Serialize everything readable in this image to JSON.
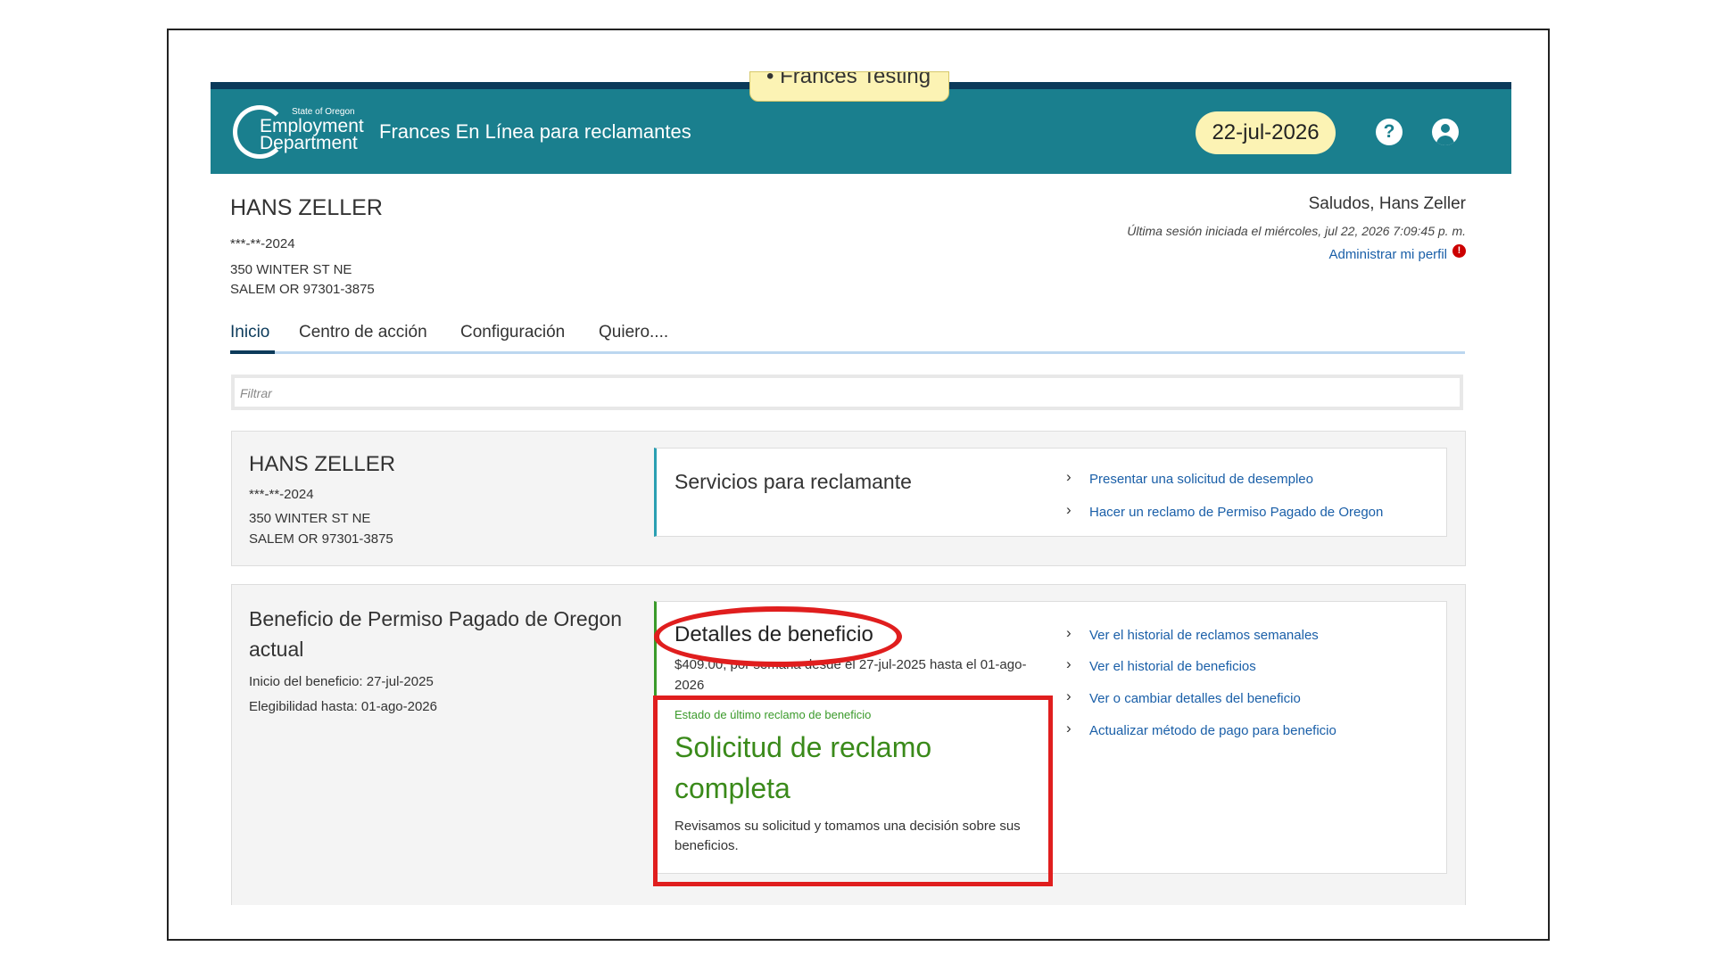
{
  "header": {
    "testing_tab": "• Frances Testing",
    "logo": {
      "small": "State of Oregon",
      "line1": "Employment",
      "line2": "Department"
    },
    "app_title": "Frances En Línea para reclamantes",
    "date": "22-jul-2026"
  },
  "profile": {
    "name": "HANS ZELLER",
    "ssn": "***-**-2024",
    "address1": "350 WINTER ST NE",
    "address2": "SALEM OR 97301-3875",
    "greeting": "Saludos, Hans Zeller",
    "last_session": "Última sesión iniciada el miércoles, jul 22, 2026 7:09:45 p. m.",
    "manage_profile": "Administrar mi perfil",
    "alert_count": "!"
  },
  "tabs": [
    "Inicio",
    "Centro de acción",
    "Configuración",
    "Quiero...."
  ],
  "filter": {
    "placeholder": "Filtrar"
  },
  "claimant_card": {
    "name": "HANS ZELLER",
    "ssn": "***-**-2024",
    "address1": "350 WINTER ST NE",
    "address2": "SALEM OR 97301-3875",
    "services_title": "Servicios para reclamante",
    "links": [
      "Presentar una solicitud de desempleo",
      "Hacer un reclamo de Permiso Pagado de Oregon"
    ]
  },
  "benefit_card": {
    "title": "Beneficio de Permiso Pagado de Oregon actual",
    "start": "Inicio del beneficio: 27-jul-2025",
    "eligibility": "Elegibilidad hasta: 01-ago-2026",
    "details_title": "Detalles de beneficio",
    "details_desc": "$409.00, por semana desde el 27-jul-2025 hasta el 01-ago-2026",
    "status_label": "Estado de último reclamo de beneficio",
    "status": "Solicitud de reclamo completa",
    "status_desc": "Revisamos su solicitud y tomamos una decisión sobre sus beneficios.",
    "links": [
      "Ver el historial de reclamos semanales",
      "Ver el historial de beneficios",
      "Ver o cambiar detalles del beneficio",
      "Actualizar método de pago para beneficio"
    ]
  },
  "colors": {
    "header": "#1a7f8e",
    "accent_red": "#e01e1e",
    "status_green": "#3a8a1a",
    "link": "#1a5fa8"
  }
}
